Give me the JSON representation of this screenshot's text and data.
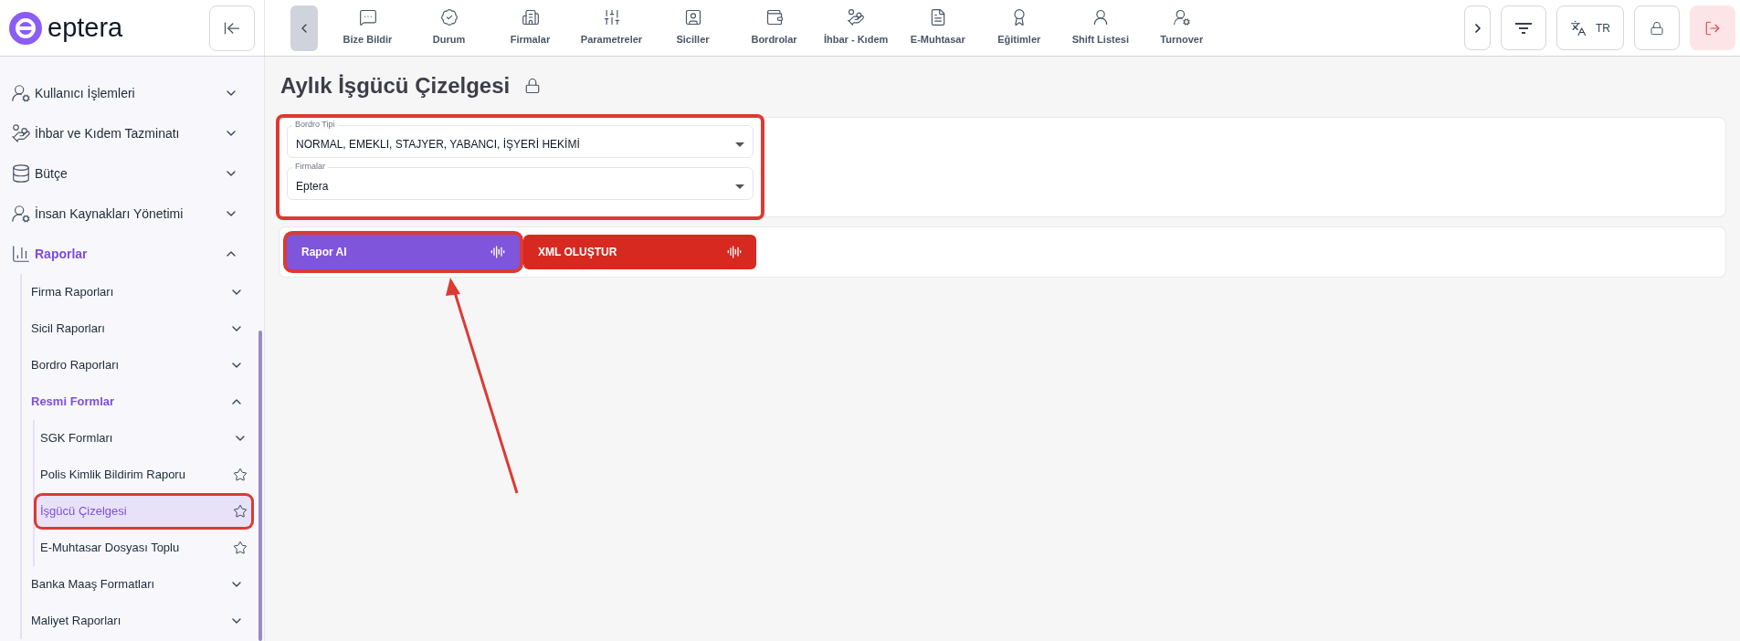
{
  "brand": {
    "name": "eptera"
  },
  "nav": [
    {
      "label": "Bize Bildir"
    },
    {
      "label": "Durum"
    },
    {
      "label": "Firmalar"
    },
    {
      "label": "Parametreler"
    },
    {
      "label": "Siciller"
    },
    {
      "label": "Bordrolar"
    },
    {
      "label": "İhbar - Kıdem"
    },
    {
      "label": "E-Muhtasar"
    },
    {
      "label": "Eğitimler"
    },
    {
      "label": "Shift Listesi"
    },
    {
      "label": "Turnover"
    }
  ],
  "language": {
    "label": "TR"
  },
  "sidebar": {
    "items": [
      {
        "label": "Kullanıcı İşlemleri",
        "expanded": false,
        "selected": false
      },
      {
        "label": "İhbar ve Kıdem Tazminatı",
        "expanded": false,
        "selected": false
      },
      {
        "label": "Bütçe",
        "expanded": false,
        "selected": false
      },
      {
        "label": "İnsan Kaynakları Yönetimi",
        "expanded": false,
        "selected": false
      },
      {
        "label": "Raporlar",
        "expanded": true,
        "selected": true,
        "children": [
          {
            "kind": "group",
            "label": "Firma Raporları",
            "expanded": false,
            "selected": false
          },
          {
            "kind": "group",
            "label": "Sicil Raporları",
            "expanded": false,
            "selected": false
          },
          {
            "kind": "group",
            "label": "Bordro Raporları",
            "expanded": false,
            "selected": false
          },
          {
            "kind": "group",
            "label": "Resmi Formlar",
            "expanded": true,
            "selected": true,
            "children": [
              {
                "kind": "group",
                "label": "SGK Formları",
                "expanded": false,
                "selected": false
              },
              {
                "kind": "page",
                "label": "Polis Kimlik Bildirim Raporu",
                "selected": false,
                "highlighted": false
              },
              {
                "kind": "page",
                "label": "İşgücü Çizelgesi",
                "selected": true,
                "highlighted": true
              },
              {
                "kind": "page",
                "label": "E-Muhtasar Dosyası Toplu",
                "selected": false,
                "highlighted": false
              }
            ]
          },
          {
            "kind": "group",
            "label": "Banka Maaş Formatları",
            "expanded": false,
            "selected": false
          },
          {
            "kind": "group",
            "label": "Maliyet Raporları",
            "expanded": false,
            "selected": false
          }
        ]
      }
    ]
  },
  "page": {
    "title": "Aylık İşgücü Çizelgesi"
  },
  "filters": {
    "highlighted": true,
    "fields": [
      {
        "label": "Bordro Tipi",
        "value": "NORMAL, EMEKLI, STAJYER, YABANCI, İŞYERİ HEKİMİ"
      },
      {
        "label": "Firmalar",
        "value": "Eptera"
      }
    ]
  },
  "actions": [
    {
      "kind": "primary",
      "label": "Rapor AI",
      "highlighted": true
    },
    {
      "kind": "danger",
      "label": "XML OLUŞTUR",
      "highlighted": false
    }
  ]
}
